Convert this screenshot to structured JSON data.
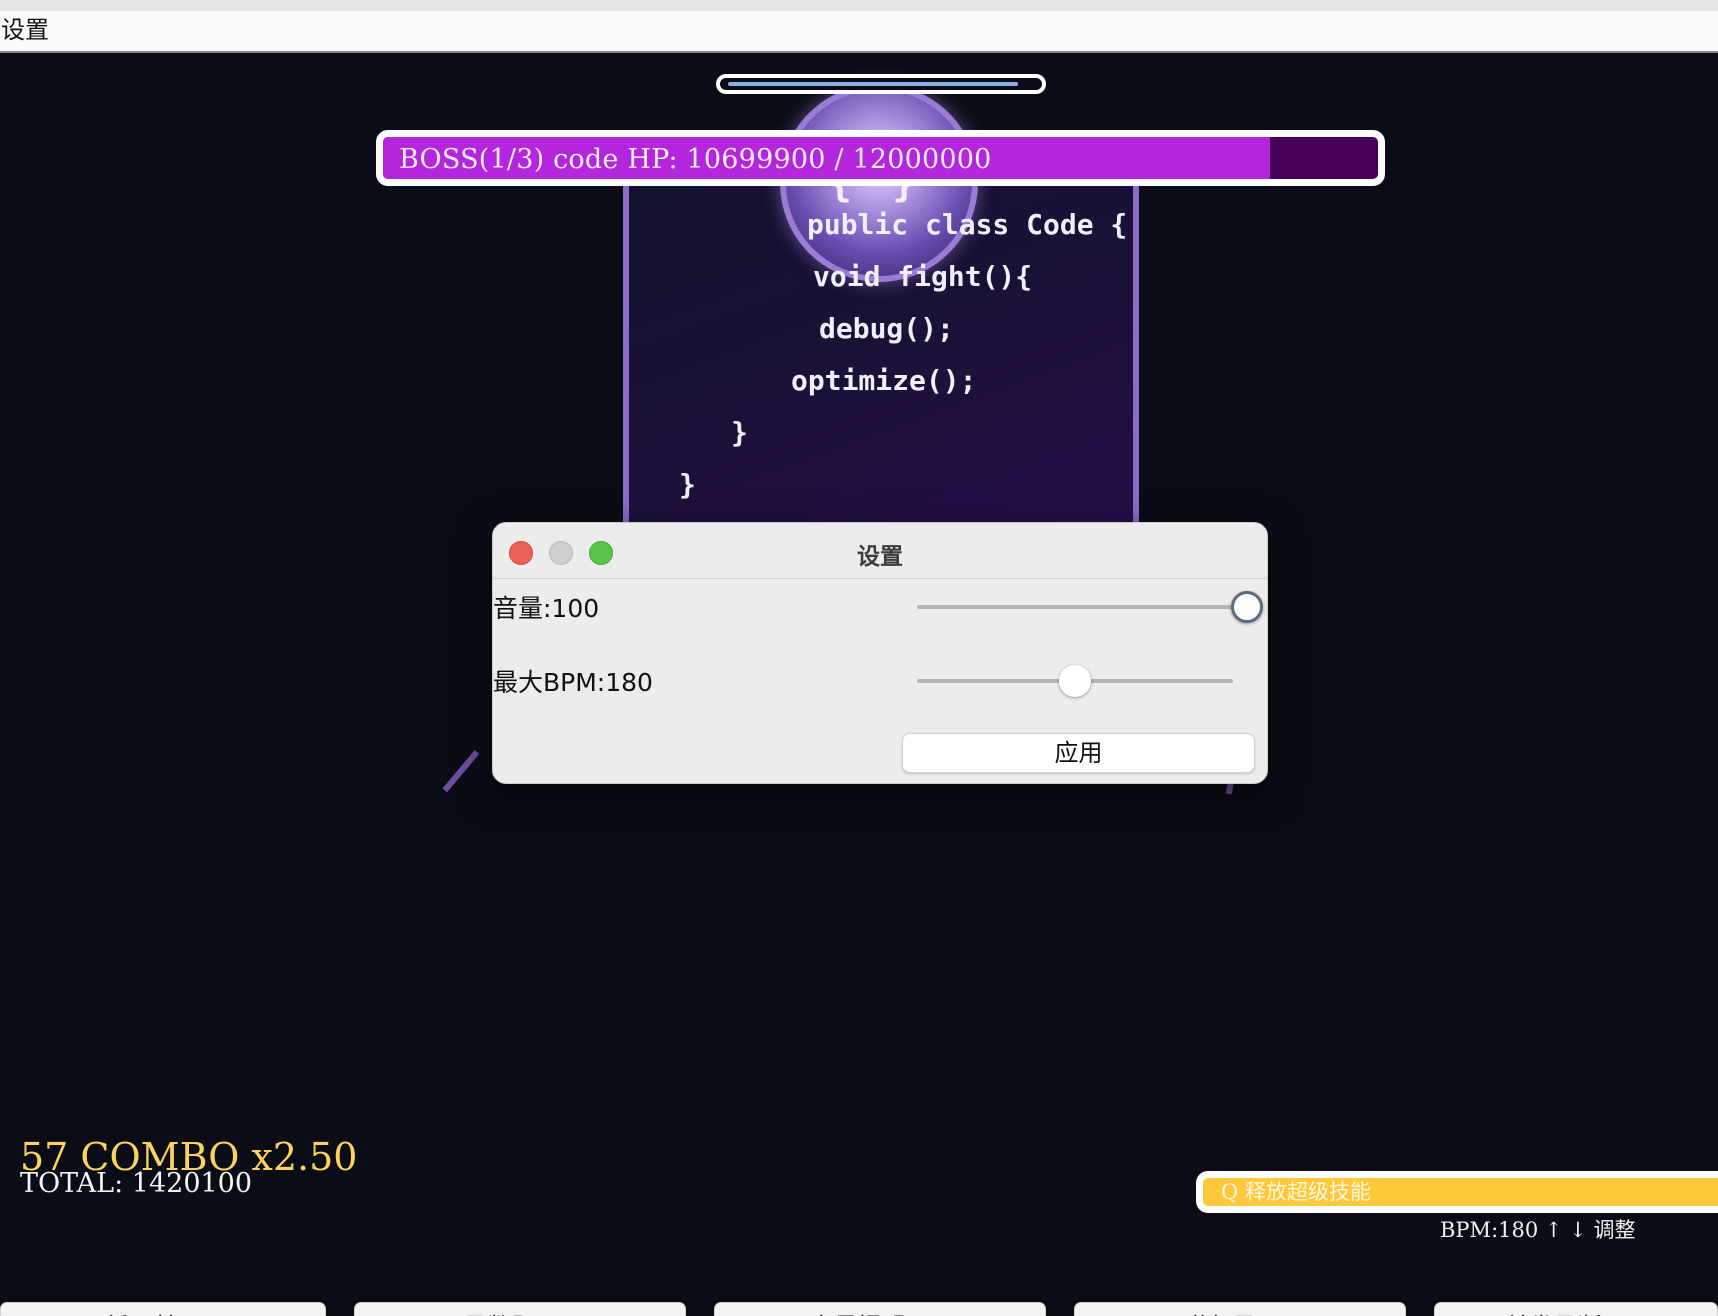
{
  "menubar": {
    "settings_label": "设置"
  },
  "boss": {
    "hp_text": "BOSS(1/3) code HP: 10699900 / 12000000",
    "hp_current": 10699900,
    "hp_max": 12000000,
    "brace": "{ }",
    "code_lines": [
      "public class Code {",
      "void fight(){",
      "debug();",
      "optimize();",
      "}",
      "}"
    ]
  },
  "hud": {
    "combo": "57 COMBO x2.50",
    "total": "TOTAL: 1420100",
    "skill_label": "Q 释放超级技能",
    "bpm_hint": "BPM:180 ↑ ↓ 调整"
  },
  "dialog": {
    "title": "设置",
    "volume_label": "音量:100",
    "volume_value": 100,
    "bpm_label": "最大BPM:180",
    "bpm_fraction": 0.5,
    "apply_label": "应用"
  },
  "bottom_tabs": [
    "循环鼓 (A)",
    "函数题 (S)",
    "变量提醒 (D)",
    "递归号 (F)",
    "并发号断 (G)"
  ],
  "colors": {
    "hp_fill": "#b426dc",
    "hp_empty": "#470059",
    "combo": "#ffd25a",
    "skill": "#ffc83a",
    "background": "#0a0d16"
  }
}
